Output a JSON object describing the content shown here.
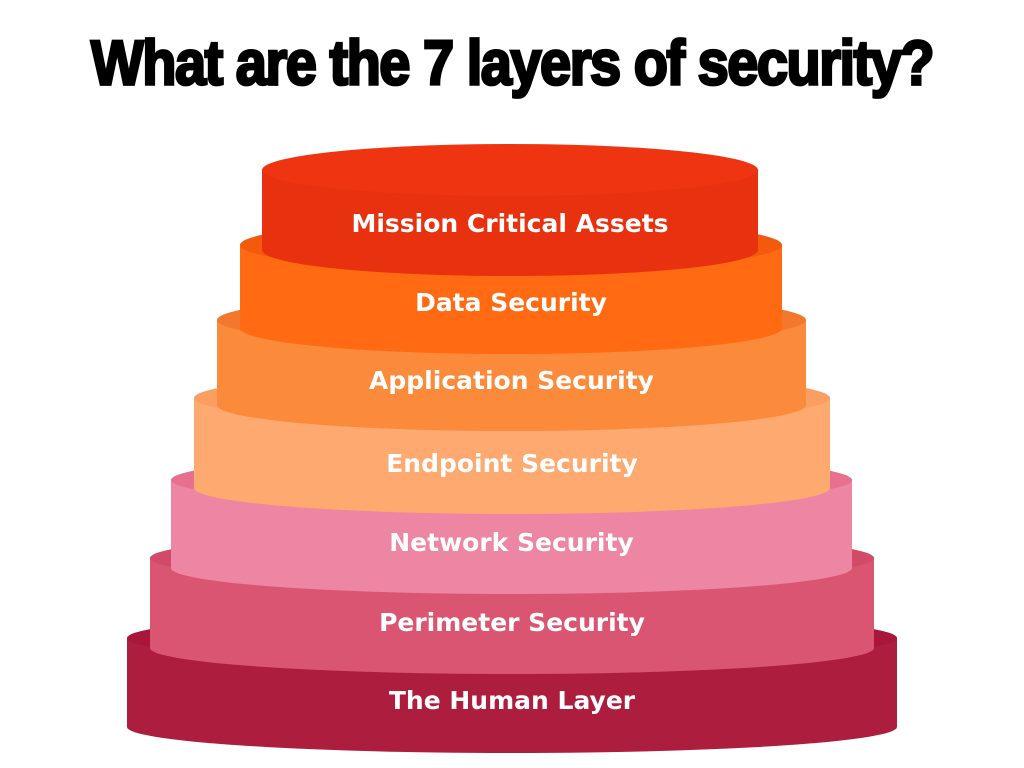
{
  "title": "What are the 7 layers of security?",
  "layers": [
    {
      "label": "Mission Critical Assets",
      "top_color": "#EE3410",
      "body_color": "#E8320F"
    },
    {
      "label": "Data Security",
      "top_color": "#F45A0E",
      "body_color": "#FF6A12"
    },
    {
      "label": "Application Security",
      "top_color": "#F3782E",
      "body_color": "#FB8A3A"
    },
    {
      "label": "Endpoint Security",
      "top_color": "#FA9E62",
      "body_color": "#FDA970"
    },
    {
      "label": "Network Security",
      "top_color": "#E7708F",
      "body_color": "#EC86A2"
    },
    {
      "label": "Perimeter Security",
      "top_color": "#D14A68",
      "body_color": "#D95572"
    },
    {
      "label": "The Human Layer",
      "top_color": "#A8173A",
      "body_color": "#AD1E3E"
    }
  ]
}
